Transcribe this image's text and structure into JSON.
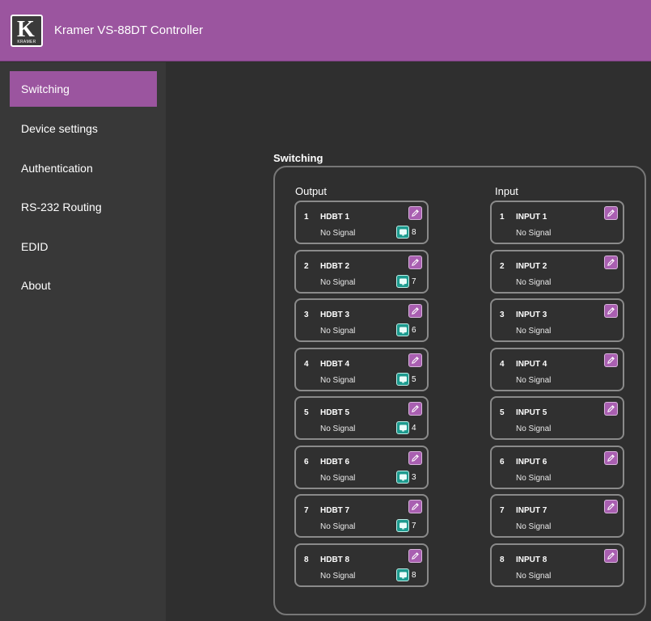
{
  "header": {
    "logo_text": "K",
    "logo_word": "KRAMER",
    "title": "Kramer VS-88DT Controller"
  },
  "sidebar": {
    "items": [
      {
        "label": "Switching",
        "active": true
      },
      {
        "label": "Device settings"
      },
      {
        "label": "Authentication"
      },
      {
        "label": "RS-232 Routing"
      },
      {
        "label": "EDID"
      },
      {
        "label": "About"
      }
    ]
  },
  "switching": {
    "title": "Switching",
    "output_title": "Output",
    "input_title": "Input",
    "outputs": [
      {
        "num": "1",
        "name": "HDBT 1",
        "status": "No Signal",
        "routed_input": "8"
      },
      {
        "num": "2",
        "name": "HDBT 2",
        "status": "No Signal",
        "routed_input": "7"
      },
      {
        "num": "3",
        "name": "HDBT 3",
        "status": "No Signal",
        "routed_input": "6"
      },
      {
        "num": "4",
        "name": "HDBT 4",
        "status": "No Signal",
        "routed_input": "5"
      },
      {
        "num": "5",
        "name": "HDBT 5",
        "status": "No Signal",
        "routed_input": "4"
      },
      {
        "num": "6",
        "name": "HDBT 6",
        "status": "No Signal",
        "routed_input": "3"
      },
      {
        "num": "7",
        "name": "HDBT 7",
        "status": "No Signal",
        "routed_input": "7"
      },
      {
        "num": "8",
        "name": "HDBT 8",
        "status": "No Signal",
        "routed_input": "8"
      }
    ],
    "inputs": [
      {
        "num": "1",
        "name": "INPUT 1",
        "status": "No Signal"
      },
      {
        "num": "2",
        "name": "INPUT 2",
        "status": "No Signal"
      },
      {
        "num": "3",
        "name": "INPUT 3",
        "status": "No Signal"
      },
      {
        "num": "4",
        "name": "INPUT 4",
        "status": "No Signal"
      },
      {
        "num": "5",
        "name": "INPUT 5",
        "status": "No Signal"
      },
      {
        "num": "6",
        "name": "INPUT 6",
        "status": "No Signal"
      },
      {
        "num": "7",
        "name": "INPUT 7",
        "status": "No Signal"
      },
      {
        "num": "8",
        "name": "INPUT 8",
        "status": "No Signal"
      }
    ]
  },
  "colors": {
    "accent": "#9b559f",
    "route": "#1d9b8f",
    "background": "#2f2f2f",
    "sidebar": "#383838"
  },
  "icons": {
    "edit": "pencil-icon",
    "route": "monitor-icon",
    "logo": "kramer-logo"
  }
}
